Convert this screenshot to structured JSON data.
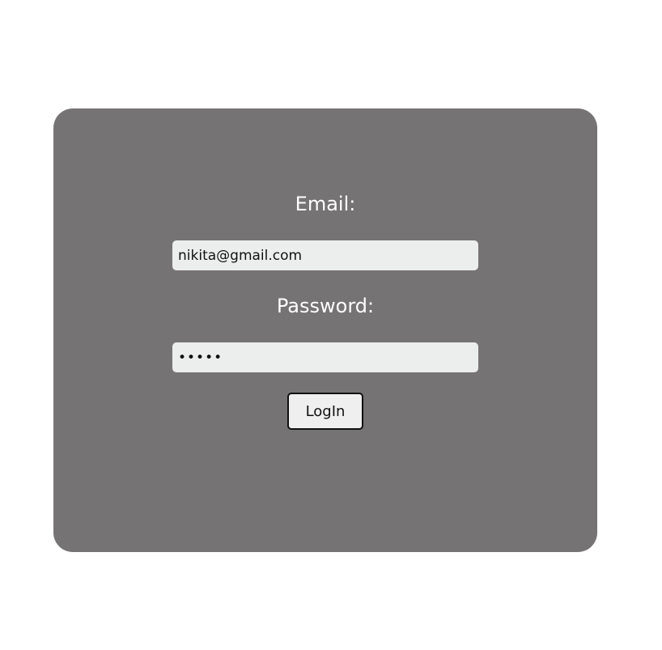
{
  "login_form": {
    "email_label": "Email:",
    "email_value": "nikita@gmail.com",
    "password_label": "Password:",
    "password_value": "12345",
    "login_button_label": "LogIn"
  },
  "colors": {
    "page_background": "#ffffff",
    "card_background": "#767374",
    "label_text": "#ffffff",
    "input_background": "#eceded",
    "button_background": "#efefef",
    "button_border": "#111111"
  }
}
